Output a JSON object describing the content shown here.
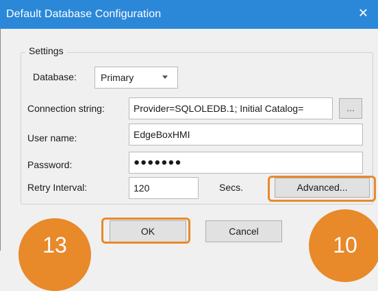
{
  "window": {
    "title": "Default Database Configuration",
    "close_glyph": "✕"
  },
  "settings": {
    "group_label": "Settings",
    "database": {
      "label": "Database:",
      "value": "Primary"
    },
    "connection_string": {
      "label": "Connection string:",
      "value": "Provider=SQLOLEDB.1; Initial Catalog=",
      "browse_label": "..."
    },
    "user_name": {
      "label": "User name:",
      "value": "EdgeBoxHMI"
    },
    "password": {
      "label": "Password:",
      "value": "●●●●●●●"
    },
    "retry_interval": {
      "label": "Retry Interval:",
      "value": "120",
      "unit": "Secs.",
      "advanced_label": "Advanced..."
    }
  },
  "buttons": {
    "ok_label": "OK",
    "cancel_label": "Cancel"
  },
  "callouts": {
    "left": "13",
    "right": "10"
  },
  "colors": {
    "title_bar": "#2b88d8",
    "highlight": "#e8892a"
  }
}
